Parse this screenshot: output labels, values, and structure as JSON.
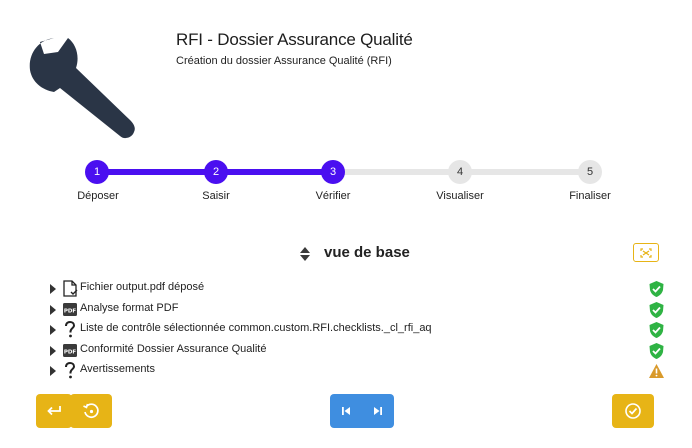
{
  "header": {
    "title": "RFI - Dossier Assurance Qualité",
    "subtitle": "Création du dossier Assurance Qualité (RFI)",
    "logo_icon": "wrench-icon"
  },
  "stepper": {
    "active_color": "#4a0ff0",
    "steps": [
      {
        "number": "1",
        "label": "Déposer",
        "active": true
      },
      {
        "number": "2",
        "label": "Saisir",
        "active": true
      },
      {
        "number": "3",
        "label": "Vérifier",
        "active": true
      },
      {
        "number": "4",
        "label": "Visualiser",
        "active": false
      },
      {
        "number": "5",
        "label": "Finaliser",
        "active": false
      }
    ]
  },
  "view": {
    "title": "vue de base"
  },
  "checks": [
    {
      "label": "Fichier output.pdf déposé",
      "icon": "file-check-icon",
      "status": "success"
    },
    {
      "label": "Analyse format PDF",
      "icon": "pdf-icon",
      "status": "success"
    },
    {
      "label": "Liste de contrôle sélectionnée common.custom.RFI.checklists._cl_rfi_aq",
      "icon": "question-icon",
      "status": "success"
    },
    {
      "label": "Conformité Dossier Assurance Qualité",
      "icon": "pdf-icon",
      "status": "success"
    },
    {
      "label": "Avertissements",
      "icon": "question-icon",
      "status": "warning"
    }
  ],
  "colors": {
    "success": "#2fb344",
    "warning": "#d99a2b",
    "yellow_button": "#e7b416",
    "blue_button": "#3f8ee0"
  },
  "buttons": {
    "back": "back-arrow-icon",
    "reset": "history-icon",
    "first": "skip-first-icon",
    "last": "skip-last-icon",
    "validate": "check-circle-icon"
  }
}
